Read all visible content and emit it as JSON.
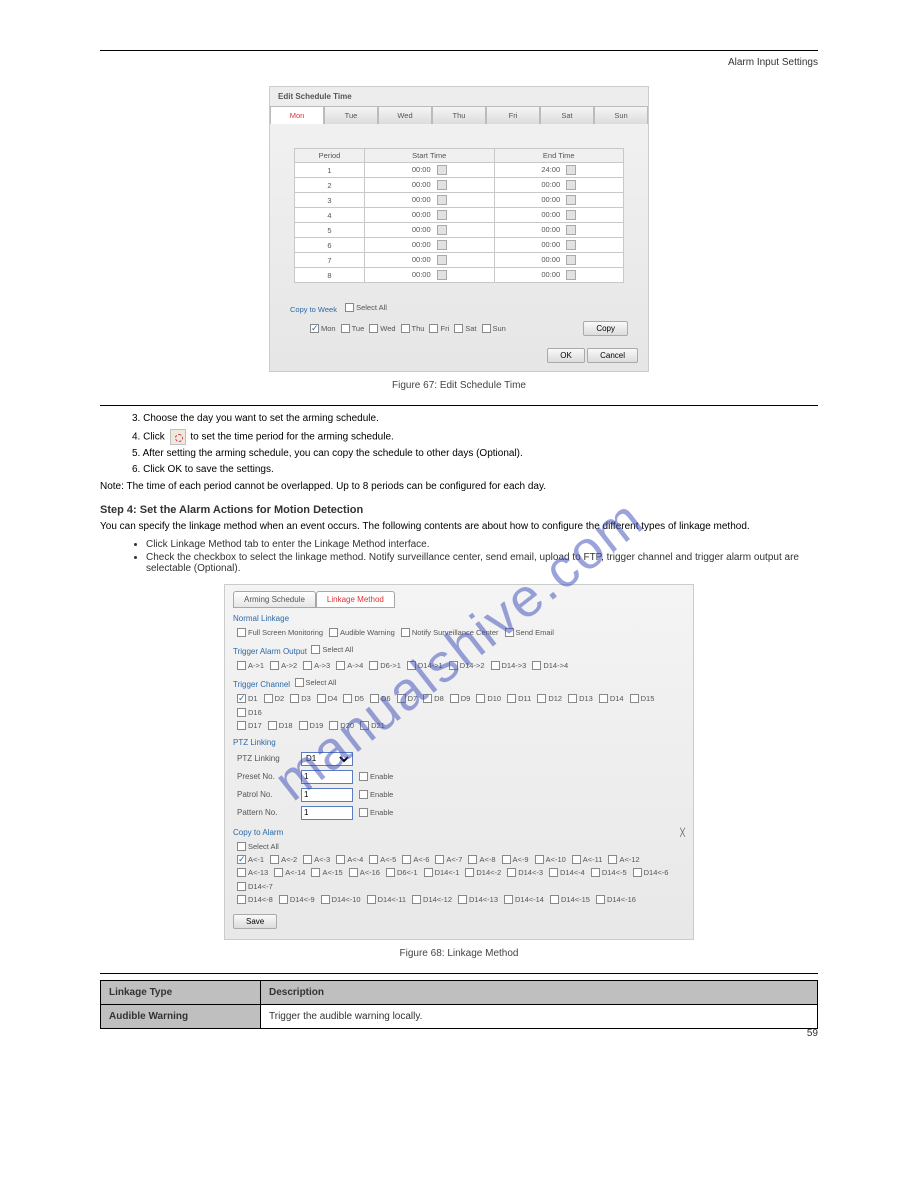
{
  "page_header": "Alarm Input Settings",
  "page_number": "59",
  "watermark": "manualshive.com",
  "panel1": {
    "title": "Edit Schedule Time",
    "days": [
      "Mon",
      "Tue",
      "Wed",
      "Thu",
      "Fri",
      "Sat",
      "Sun"
    ],
    "active_day_index": 0,
    "columns": {
      "period": "Period",
      "start": "Start Time",
      "end": "End Time"
    },
    "rows": [
      {
        "period": "1",
        "start": "00:00",
        "end": "24:00"
      },
      {
        "period": "2",
        "start": "00:00",
        "end": "00:00"
      },
      {
        "period": "3",
        "start": "00:00",
        "end": "00:00"
      },
      {
        "period": "4",
        "start": "00:00",
        "end": "00:00"
      },
      {
        "period": "5",
        "start": "00:00",
        "end": "00:00"
      },
      {
        "period": "6",
        "start": "00:00",
        "end": "00:00"
      },
      {
        "period": "7",
        "start": "00:00",
        "end": "00:00"
      },
      {
        "period": "8",
        "start": "00:00",
        "end": "00:00"
      }
    ],
    "copy_to_label": "Copy to Week",
    "select_all_label": "Select All",
    "select_all_checked": false,
    "weekdays": [
      {
        "label": "Mon",
        "checked": true
      },
      {
        "label": "Tue",
        "checked": false
      },
      {
        "label": "Wed",
        "checked": false
      },
      {
        "label": "Thu",
        "checked": false
      },
      {
        "label": "Fri",
        "checked": false
      },
      {
        "label": "Sat",
        "checked": false
      },
      {
        "label": "Sun",
        "checked": false
      }
    ],
    "copy_btn": "Copy",
    "ok_btn": "OK",
    "cancel_btn": "Cancel"
  },
  "caption1": "Figure 67: Edit Schedule Time",
  "step3": {
    "sentence_a": "3. Choose the day you want to set the arming schedule.",
    "sentence_b_pre": "4. Click ",
    "sentence_b_post": " to set the time period for the arming schedule.",
    "sentence_c": "5. After setting the arming schedule, you can copy the schedule to other days (Optional).",
    "sentence_d": "6. Click OK to save the settings."
  },
  "note": "Note: The time of each period cannot be overlapped. Up to 8 periods can be configured for each day.",
  "step4_title": "Step 4: Set the Alarm Actions for Motion Detection",
  "step4_p1": "You can specify the linkage method when an event occurs. The following contents are about how to configure the different types of linkage method.",
  "step4_li1": "Check the checkbox to select the linkage method. Notify surveillance center, send email, upload to FTP, trigger channel and trigger alarm output are selectable (Optional).",
  "step4_li2": "Click Linkage Method tab to enter the Linkage Method interface.",
  "panel2": {
    "tab1": "Arming Schedule",
    "tab2": "Linkage Method",
    "section_normal": "Normal Linkage",
    "normal_options": [
      {
        "label": "Full Screen Monitoring",
        "checked": false
      },
      {
        "label": "Audible Warning",
        "checked": false
      },
      {
        "label": "Notify Surveillance Center",
        "checked": false
      },
      {
        "label": "Send Email",
        "checked": false
      }
    ],
    "section_trigger_out": "Trigger Alarm Output",
    "select_all": "Select All",
    "trigger_outputs": [
      "A->1",
      "A->2",
      "A->3",
      "A->4",
      "D6->1",
      "D14->1",
      "D14->2",
      "D14->3",
      "D14->4"
    ],
    "section_trigger_ch": "Trigger Channel",
    "channels_row1": [
      "D1",
      "D2",
      "D3",
      "D4",
      "D5",
      "D6",
      "D7",
      "D8",
      "D9",
      "D10",
      "D11",
      "D12",
      "D13",
      "D14",
      "D15",
      "D16"
    ],
    "channels_row2": [
      "D17",
      "D18",
      "D19",
      "D20",
      "D21"
    ],
    "d1_checked": true,
    "section_ptz": "PTZ Linking",
    "ptz_linking_label": "PTZ Linking",
    "ptz_linking_value": "D1",
    "preset_label": "Preset No.",
    "preset_value": "1",
    "patrol_label": "Patrol No.",
    "patrol_value": "1",
    "pattern_label": "Pattern No.",
    "pattern_value": "1",
    "enable_label": "Enable",
    "section_copy": "Copy to Alarm",
    "copy_row1": [
      "A<-1",
      "A<-2",
      "A<-3",
      "A<-4",
      "A<-5",
      "A<-6",
      "A<-7",
      "A<-8",
      "A<-9",
      "A<-10",
      "A<-11",
      "A<-12"
    ],
    "copy_row2": [
      "A<-13",
      "A<-14",
      "A<-15",
      "A<-16",
      "D6<-1",
      "D14<-1",
      "D14<-2",
      "D14<-3",
      "D14<-4",
      "D14<-5",
      "D14<-6",
      "D14<-7"
    ],
    "copy_row3": [
      "D14<-8",
      "D14<-9",
      "D14<-10",
      "D14<-11",
      "D14<-12",
      "D14<-13",
      "D14<-14",
      "D14<-15",
      "D14<-16"
    ],
    "a1_checked": true,
    "save_btn": "Save"
  },
  "caption2": "Figure 68: Linkage Method",
  "table_hdr_type": "Linkage Type",
  "table_hdr_desc": "Description",
  "table_row1_k": "Audible Warning",
  "table_row1_v": "Trigger the audible warning locally."
}
